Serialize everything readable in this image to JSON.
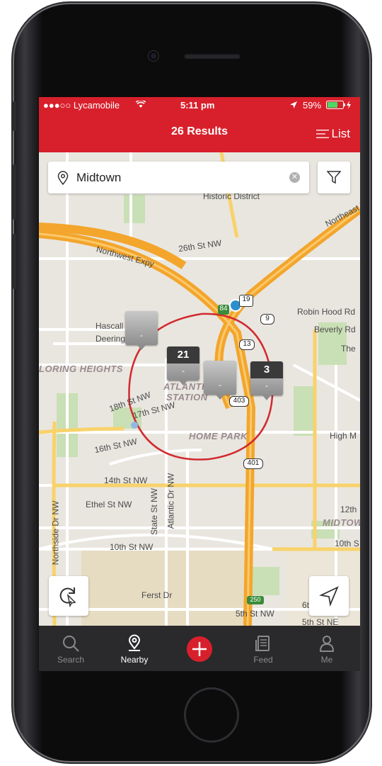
{
  "status_bar": {
    "carrier": "●●●○○ Lycamobile",
    "time": "5:11 pm",
    "battery": "59%"
  },
  "nav": {
    "title": "26 Results",
    "list_label": "List"
  },
  "search": {
    "location": "Midtown"
  },
  "map": {
    "labels": {
      "historic": "Historic District",
      "st26": "26th St NW",
      "northwest": "Northwest Expy",
      "hascall": "Hascall",
      "deering": "Deering",
      "loring": "LORING HEIGHTS",
      "atlantic": "ATLANTIC",
      "station": "STATION",
      "st18": "18th St NW",
      "st17": "17th St NW",
      "st16": "16th St NW",
      "homepark": "HOME PARK",
      "st14": "14th St NW",
      "ethel": "Ethel St NW",
      "statest": "State St NW",
      "atlanticdr": "Atlantic Dr NW",
      "northside": "Northside Dr NW",
      "st10": "10th St NW",
      "ferst": "Ferst Dr",
      "st5": "5th St NW",
      "robinhood": "Robin Hood Rd",
      "beverly": "Beverly Rd",
      "the": "The",
      "highm": "High M",
      "st12": "12th",
      "midtown": "MIDTOW",
      "st10b": "10th S",
      "st5ne": "5th St NE",
      "st6": "6t",
      "northeast": "Northeast E",
      "shields": {
        "s84": "84",
        "s19": "19",
        "s9": "9",
        "s13": "13",
        "s403": "403",
        "s401": "401",
        "s250": "250"
      }
    },
    "pins": [
      {
        "count": "",
        "sub": "-",
        "dark": false
      },
      {
        "count": "21",
        "sub": "-",
        "dark": true
      },
      {
        "count": "",
        "sub": "-",
        "dark": false
      },
      {
        "count": "3",
        "sub": "-",
        "dark": true
      }
    ]
  },
  "tabs": [
    {
      "label": "Search",
      "icon": "search-icon",
      "active": false
    },
    {
      "label": "Nearby",
      "icon": "location-pin-icon",
      "active": true
    },
    {
      "label": "Feed",
      "icon": "feed-icon",
      "active": false
    },
    {
      "label": "Me",
      "icon": "person-icon",
      "active": false
    }
  ],
  "colors": {
    "brand": "#d8202c",
    "tabbar": "#2a2a2c",
    "highway": "#f5a623",
    "radius": "#d8202c"
  }
}
